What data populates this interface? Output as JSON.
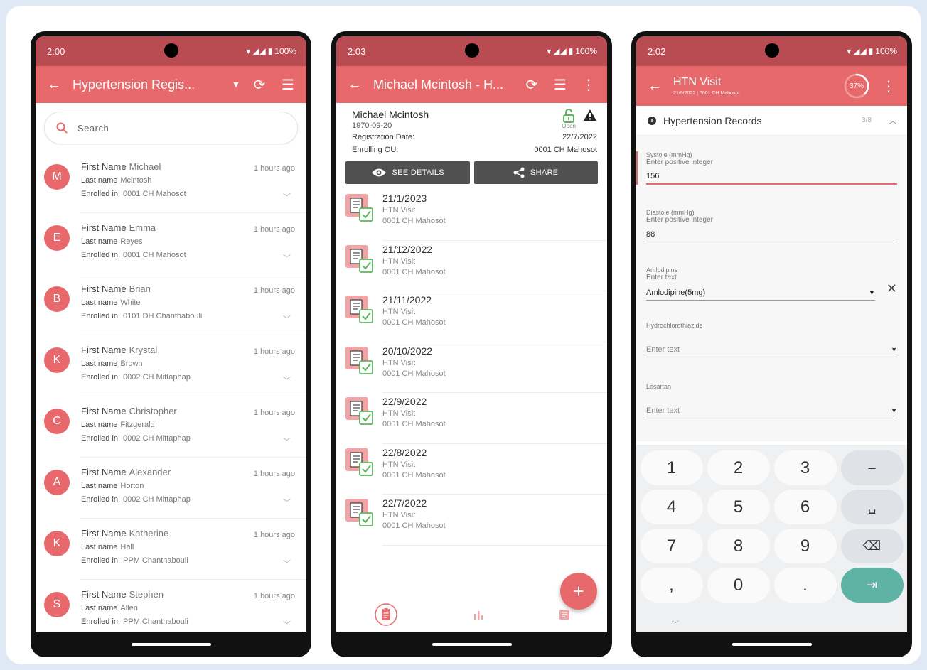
{
  "colors": {
    "primary": "#e8696c",
    "status_bar": "#b94c53",
    "accent_teal": "#5fb3a4",
    "open_green": "#5cb85c"
  },
  "phone1": {
    "status": {
      "time": "2:00",
      "battery": "100%"
    },
    "appbar": {
      "title": "Hypertension Regis...",
      "icons": [
        "back-arrow-icon",
        "dropdown-icon",
        "sync-icon",
        "filter-icon"
      ]
    },
    "search": {
      "placeholder": "Search"
    },
    "people": [
      {
        "initial": "M",
        "first_label": "First Name",
        "first": "Michael",
        "last_label": "Last name",
        "last": "Mcintosh",
        "enrolled_label": "Enrolled in:",
        "enrolled": "0001 CH Mahosot",
        "time": "1 hours ago"
      },
      {
        "initial": "E",
        "first_label": "First Name",
        "first": "Emma",
        "last_label": "Last name",
        "last": "Reyes",
        "enrolled_label": "Enrolled in:",
        "enrolled": "0001 CH Mahosot",
        "time": "1 hours ago"
      },
      {
        "initial": "B",
        "first_label": "First Name",
        "first": "Brian",
        "last_label": "Last name",
        "last": "White",
        "enrolled_label": "Enrolled in:",
        "enrolled": "0101 DH Chanthabouli",
        "time": "1 hours ago"
      },
      {
        "initial": "K",
        "first_label": "First Name",
        "first": "Krystal",
        "last_label": "Last name",
        "last": "Brown",
        "enrolled_label": "Enrolled in:",
        "enrolled": "0002 CH Mittaphap",
        "time": "1 hours ago"
      },
      {
        "initial": "C",
        "first_label": "First Name",
        "first": "Christopher",
        "last_label": "Last name",
        "last": "Fitzgerald",
        "enrolled_label": "Enrolled in:",
        "enrolled": "0002 CH Mittaphap",
        "time": "1 hours ago"
      },
      {
        "initial": "A",
        "first_label": "First Name",
        "first": "Alexander",
        "last_label": "Last name",
        "last": "Horton",
        "enrolled_label": "Enrolled in:",
        "enrolled": "0002 CH Mittaphap",
        "time": "1 hours ago"
      },
      {
        "initial": "K",
        "first_label": "First Name",
        "first": "Katherine",
        "last_label": "Last name",
        "last": "Hall",
        "enrolled_label": "Enrolled in:",
        "enrolled": "PPM Chanthabouli",
        "time": "1 hours ago"
      },
      {
        "initial": "S",
        "first_label": "First Name",
        "first": "Stephen",
        "last_label": "Last name",
        "last": "Allen",
        "enrolled_label": "Enrolled in:",
        "enrolled": "PPM Chanthabouli",
        "time": "1 hours ago"
      }
    ]
  },
  "phone2": {
    "status": {
      "time": "2:03",
      "battery": "100%"
    },
    "appbar": {
      "title": "Michael Mcintosh - H...",
      "icons": [
        "back-arrow-icon",
        "sync-icon",
        "filter-icon",
        "more-vert-icon"
      ]
    },
    "header": {
      "name": "Michael Mcintosh",
      "dob": "1970-09-20",
      "lock_label": "Open",
      "registration_label": "Registration Date:",
      "registration_value": "22/7/2022",
      "ou_label": "Enrolling OU:",
      "ou_value": "0001 CH Mahosot"
    },
    "buttons": {
      "details": "SEE DETAILS",
      "share": "SHARE"
    },
    "events": [
      {
        "date": "21/1/2023",
        "program": "HTN Visit",
        "org": "0001 CH Mahosot"
      },
      {
        "date": "21/12/2022",
        "program": "HTN Visit",
        "org": "0001 CH Mahosot"
      },
      {
        "date": "21/11/2022",
        "program": "HTN Visit",
        "org": "0001 CH Mahosot"
      },
      {
        "date": "20/10/2022",
        "program": "HTN Visit",
        "org": "0001 CH Mahosot"
      },
      {
        "date": "22/9/2022",
        "program": "HTN Visit",
        "org": "0001 CH Mahosot"
      },
      {
        "date": "22/8/2022",
        "program": "HTN Visit",
        "org": "0001 CH Mahosot"
      },
      {
        "date": "22/7/2022",
        "program": "HTN Visit",
        "org": "0001 CH Mahosot"
      }
    ],
    "fab": "+"
  },
  "phone3": {
    "status": {
      "time": "2:02",
      "battery": "100%"
    },
    "appbar": {
      "title": "HTN Visit",
      "subtitle": "21/9/2022 | 0001 CH Mahosot",
      "progress": "37%",
      "progress_fraction": 0.37
    },
    "section": {
      "title": "Hypertension Records",
      "count": "3/8"
    },
    "fields": {
      "systole": {
        "label": "Systole (mmHg)",
        "hint": "Enter positive integer",
        "value": "156"
      },
      "diastole": {
        "label": "Diastole (mmHg)",
        "hint": "Enter positive integer",
        "value": "88"
      },
      "amlodipine": {
        "label": "Amlodipine",
        "hint": "Enter text",
        "value": "Amlodipine(5mg)"
      },
      "hctz": {
        "label": "Hydrochlorothiazide",
        "placeholder": "Enter text"
      },
      "losartan": {
        "label": "Losartan",
        "placeholder": "Enter text"
      }
    },
    "keypad": {
      "rows": [
        [
          "1",
          "2",
          "3",
          "–"
        ],
        [
          "4",
          "5",
          "6",
          "␣"
        ],
        [
          "7",
          "8",
          "9",
          "⌫"
        ],
        [
          ",",
          "0",
          ".",
          "⇥"
        ]
      ]
    }
  }
}
